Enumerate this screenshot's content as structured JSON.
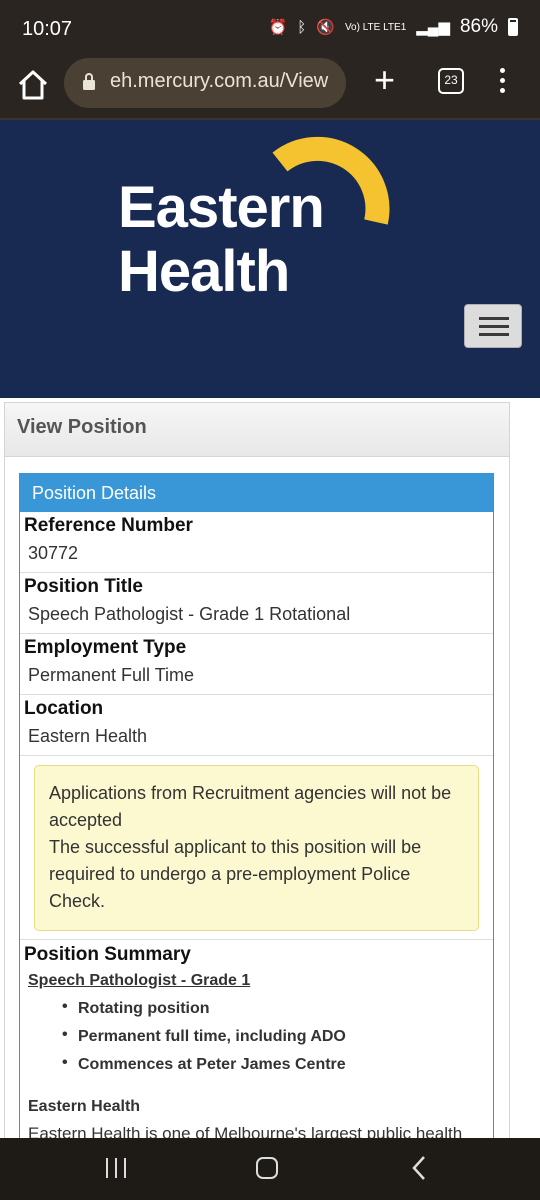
{
  "status_bar": {
    "time": "10:07",
    "network": "Vo) LTE LTE1",
    "battery": "86%"
  },
  "browser": {
    "url": "eh.mercury.com.au/View",
    "tab_count": "23",
    "icons": [
      "home-icon",
      "lock-icon",
      "plus-icon",
      "tabs-icon",
      "more-vert-icon"
    ]
  },
  "header": {
    "logo_line1": "Eastern",
    "logo_line2": "Health",
    "brand_color": "#182a52",
    "accent_color": "#f5c330"
  },
  "page": {
    "heading": "View Position",
    "panel_title": "Position Details",
    "fields": [
      {
        "label": "Reference Number",
        "value": "30772"
      },
      {
        "label": "Position Title",
        "value": "Speech Pathologist - Grade 1 Rotational"
      },
      {
        "label": "Employment Type",
        "value": "Permanent Full Time"
      },
      {
        "label": "Location",
        "value": "Eastern Health"
      }
    ],
    "alert": {
      "line1": "Applications from Recruitment agencies will not be accepted",
      "line2": "The successful applicant to this position will be required to undergo a pre-employment Police Check."
    },
    "summary": {
      "label": "Position Summary",
      "link": "Speech Pathologist - Grade 1",
      "bullets": [
        "Rotating position",
        "Permanent full time, including ADO",
        "Commences at Peter James Centre"
      ],
      "org_label": "Eastern Health",
      "org_desc": "Eastern Health is one of Melbourne's largest public health"
    }
  }
}
